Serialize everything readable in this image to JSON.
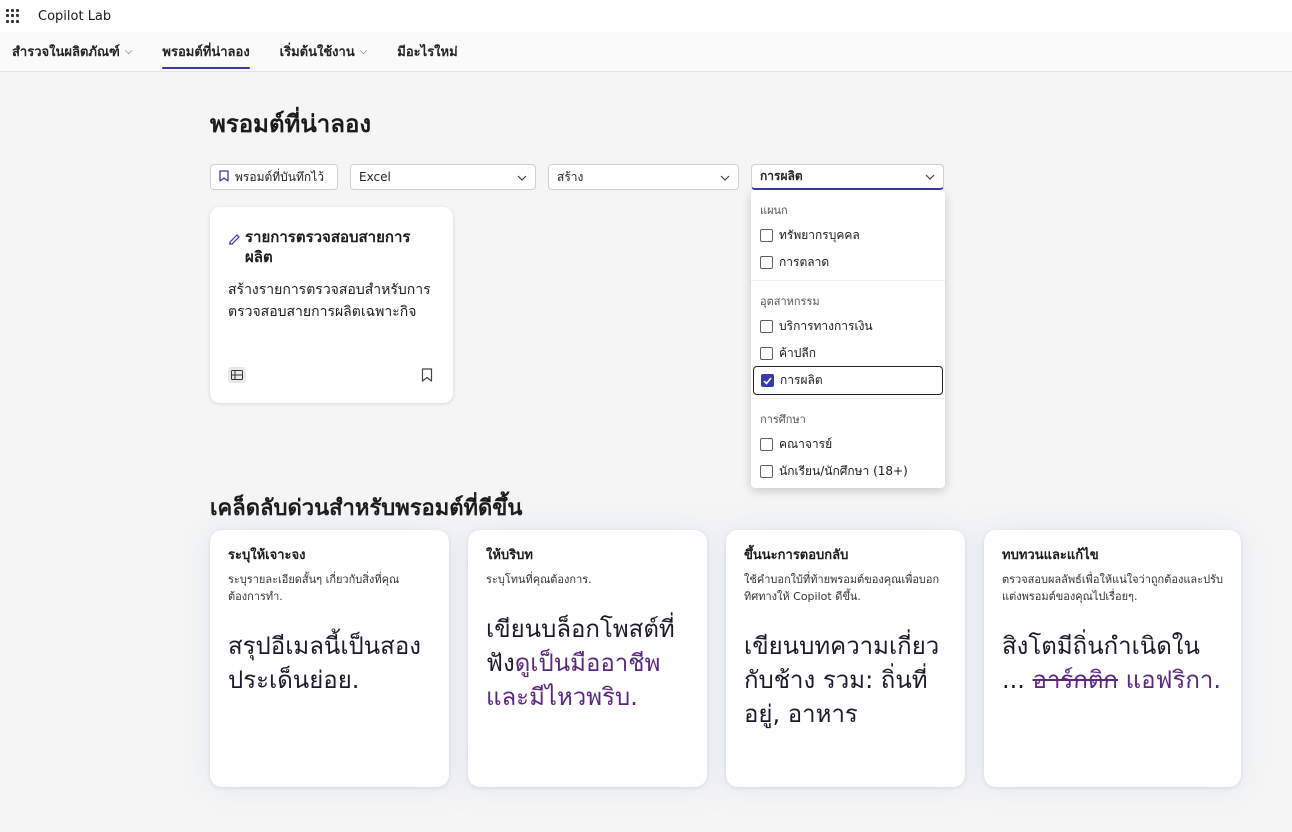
{
  "app": {
    "title": "Copilot Lab"
  },
  "nav": {
    "items": [
      {
        "label": "สำรวจในผลิตภัณฑ์",
        "has_dropdown": true,
        "active": false
      },
      {
        "label": "พรอมต์ที่น่าลอง",
        "has_dropdown": false,
        "active": true
      },
      {
        "label": "เริ่มต้นใช้งาน",
        "has_dropdown": true,
        "active": false
      },
      {
        "label": "มีอะไรใหม่",
        "has_dropdown": false,
        "active": false
      }
    ]
  },
  "page": {
    "title": "พรอมต์ที่น่าลอง"
  },
  "filters": {
    "saved_label": "พรอมต์ที่บันทึกไว้",
    "app_value": "Excel",
    "task_value": "สร้าง",
    "industry_value": "การผลิต"
  },
  "prompt_card": {
    "title": "รายการตรวจสอบสายการผลิต",
    "description": "สร้างรายการตรวจสอบสำหรับการตรวจสอบสายการผลิตเฉพาะกิจ",
    "app_icon": "excel-icon"
  },
  "dropdown": {
    "groups": [
      {
        "label": "แผนก",
        "options": [
          {
            "label": "ทรัพยากรบุคคล",
            "checked": false
          },
          {
            "label": "การตลาด",
            "checked": false
          }
        ]
      },
      {
        "label": "อุตสาหกรรม",
        "options": [
          {
            "label": "บริการทางการเงิน",
            "checked": false
          },
          {
            "label": "ค้าปลีก",
            "checked": false
          },
          {
            "label": "การผลิต",
            "checked": true
          }
        ]
      },
      {
        "label": "การศึกษา",
        "options": [
          {
            "label": "คณาจารย์",
            "checked": false
          },
          {
            "label": "นักเรียน/นักศึกษา (18+)",
            "checked": false
          }
        ]
      }
    ]
  },
  "tips": {
    "heading": "เคล็ดลับด่วนสำหรับพรอมต์ที่ดีขึ้น",
    "cards": [
      {
        "title": "ระบุให้เจาะจง",
        "description": "ระบุรายละเอียดสั้นๆ เกี่ยวกับสิ่งที่คุณต้องการทำ.",
        "example": "สรุปอีเมลนี้เป็นสองประเด็นย่อย."
      },
      {
        "title": "ให้บริบท",
        "description": "ระบุโทนที่คุณต้องการ.",
        "example_plain": "เขียนบล็อกโพสต์ที่ฟัง",
        "example_highlight": "ดูเป็นมืออาชีพและมีไหวพริบ."
      },
      {
        "title": "ขึ้นนะการตอบกลับ",
        "description": "ใช้คำบอกใบ้ที่ท้ายพรอมต์ของคุณเพื่อบอกทิศทางให้ Copilot ดีขึ้น.",
        "example": "เขียนบทความเกี่ยวกับช้าง รวม: ถิ่นที่อยู่, อาหาร"
      },
      {
        "title": "ทบทวนและแก้ไข",
        "description": "ตรวจสอบผลลัพธ์เพื่อให้แน่ใจว่าถูกต้องและปรับแต่งพรอมต์ของคุณไปเรื่อยๆ.",
        "example_plain": "สิงโตมีถิ่นกำเนิดใน ...",
        "example_struck": "อาร์กติก",
        "example_highlight": "แอฟริกา."
      }
    ]
  },
  "colors": {
    "accent": "#3b3ba5",
    "highlight_purple": "#5c2782"
  }
}
